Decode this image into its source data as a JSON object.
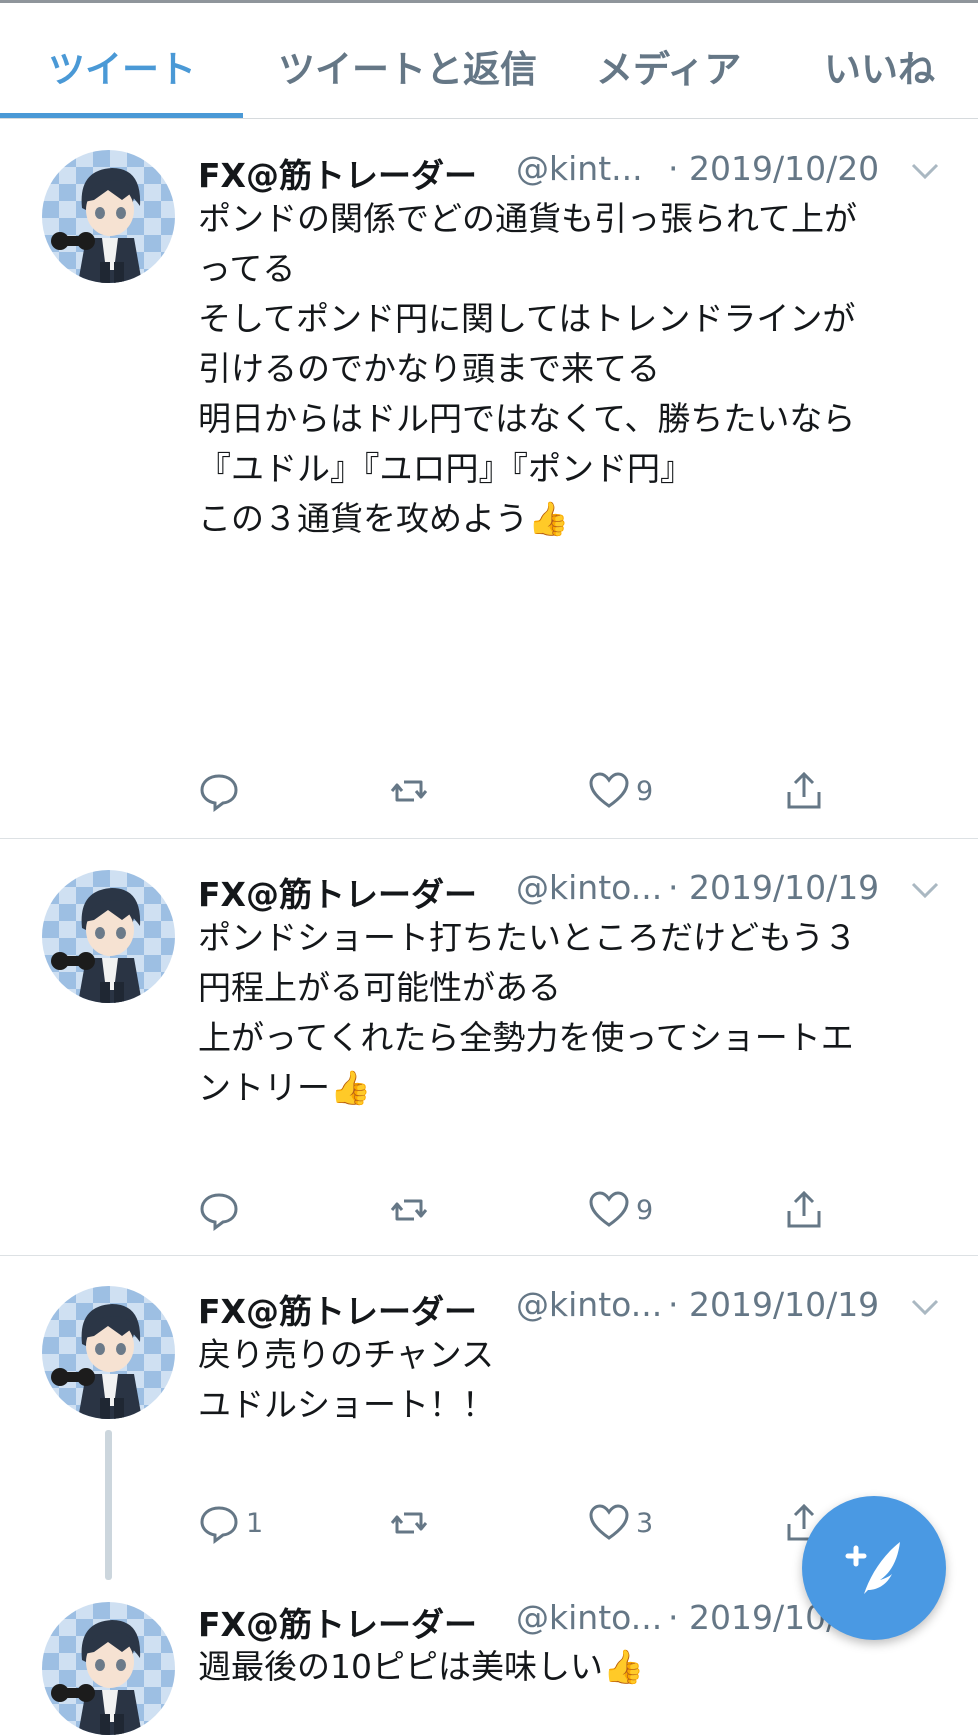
{
  "tabs": [
    {
      "label": "ツイート",
      "active": true
    },
    {
      "label": "ツイートと返信"
    },
    {
      "label": "メディア"
    },
    {
      "label": "いいね"
    }
  ],
  "colors": {
    "accent": "#4a99d6",
    "secondary_text": "#657786",
    "fab": "#4a99e3"
  },
  "tweets": [
    {
      "name": "FX@筋トレーダー",
      "handle": "@kint...",
      "date": "· 2019/10/20",
      "lines": [
        "ポンドの関係でどの通貨も引っ張られて上が",
        "ってる",
        "",
        "そしてポンド円に関してはトレンドラインが",
        "引けるのでかなり頭まで来てる",
        "",
        "明日からはドル円ではなくて、勝ちたいなら",
        "",
        "『ユドル』『ユロ円』『ポンド円』",
        "",
        "この３通貨を攻めよう👍"
      ],
      "replies": "",
      "likes": "9"
    },
    {
      "name": "FX@筋トレーダー",
      "handle": "@kinto...",
      "date": "· 2019/10/19",
      "lines": [
        "ポンドショート打ちたいところだけどもう３",
        "円程上がる可能性がある",
        "",
        "上がってくれたら全勢力を使ってショートエ",
        "ントリー👍"
      ],
      "replies": "",
      "likes": "9"
    },
    {
      "name": "FX@筋トレーダー",
      "handle": "@kinto...",
      "date": "· 2019/10/19",
      "lines": [
        "戻り売りのチャンス",
        "",
        "ユドルショート！！"
      ],
      "replies": "1",
      "likes": "3"
    },
    {
      "name": "FX@筋トレーダー",
      "handle": "@kinto...",
      "date": "· 2019/10/",
      "lines": [
        "週最後の10ピピは美味しい👍"
      ]
    }
  ],
  "icons": {
    "reply": "reply-icon",
    "retweet": "retweet-icon",
    "like": "heart-icon",
    "share": "share-icon",
    "caret": "chevron-down-icon",
    "compose": "compose-tweet-icon"
  }
}
